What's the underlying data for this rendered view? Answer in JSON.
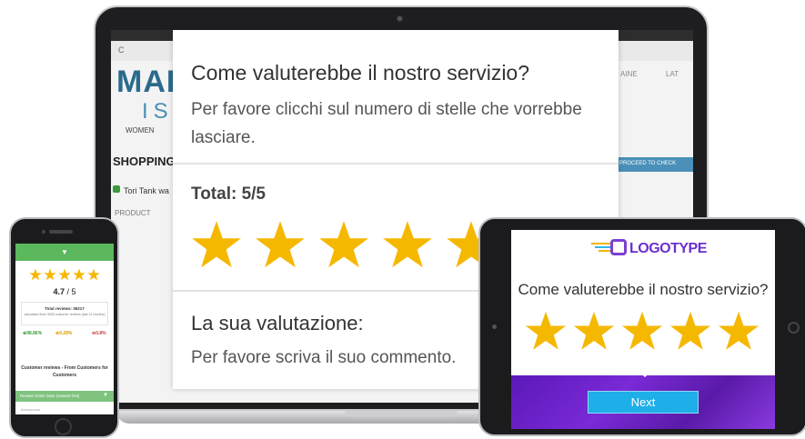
{
  "colors": {
    "star": "#f5b800",
    "phone_accent": "#5cb85c",
    "tablet_gradient": "#6b22c8",
    "next_button": "#1eaee8",
    "logo": "#6b2fcf"
  },
  "laptop": {
    "site": {
      "address": "C",
      "logo_main": "MAD",
      "logo_sub": "ISL",
      "nav_women": "WOMEN",
      "section_title": "SHOPPING",
      "cart_item": "Tori Tank wa",
      "column_product": "PRODUCT",
      "menu_right_1": "AINE",
      "menu_right_2": "LAT",
      "checkout": "PROCEED TO CHECK"
    },
    "popup": {
      "title": "Come valuterebbe il nostro servizio?",
      "subtitle": "Per favore clicchi sul numero di stelle che vorrebbe lasciare.",
      "total": "Total: 5/5",
      "rating": 5,
      "evaluation_heading": "La sua valutazione:",
      "comment_prompt": "Per favore scriva il suo commento."
    }
  },
  "phone": {
    "chevron": "▼",
    "rating_value": "4.7",
    "rating_max": " / 5",
    "rating": 5,
    "total_reviews": "Total reviews: 36217",
    "calculated_note": "calculated from 3000 customer reviews (last 12 months)",
    "positive_pct": "98.86%",
    "neutral_pct": "0.28%",
    "negative_pct": "0.8%",
    "customer_reviews_heading": "Customer reviews - From Customers for Customers",
    "sort_label": "Review Order Date (newest first)",
    "anonymous": "Anonymous"
  },
  "tablet": {
    "logo_text": "LOGOTYPE",
    "question": "Come valuterebbe il nostro servizio?",
    "rating": 5,
    "next_label": "Next"
  }
}
